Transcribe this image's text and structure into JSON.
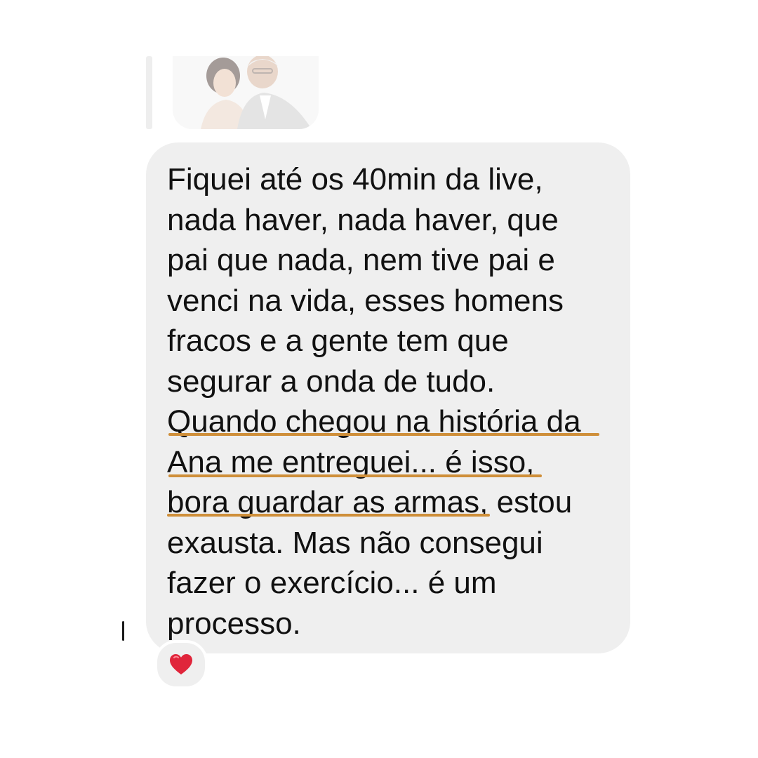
{
  "reply_preview": {
    "thumbnail_icon": "photo-thumbnail-icon"
  },
  "message": {
    "lines": [
      "Fiquei até os 40min da live,",
      "nada haver, nada haver, que",
      "pai que nada, nem tive pai e",
      "venci na vida, esses homens",
      "fracos e a gente tem que",
      "segurar a onda de tudo.",
      "Quando chegou na história da",
      "Ana me entreguei... é isso,",
      "bora guardar as armas",
      ", estou",
      "exausta. Mas não consegui",
      "fazer o exercício... é um",
      "processo."
    ],
    "bubble_color": "#efefef",
    "highlight_color": "#cf8f3a"
  },
  "reaction": {
    "icon": "red-heart-icon",
    "color": "#e0253b"
  }
}
